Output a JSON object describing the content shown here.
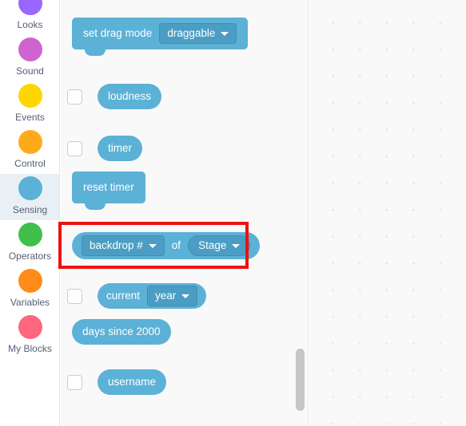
{
  "colors": {
    "sensing_block": "#5cb1d6",
    "sensing_field": "#4b9dc3",
    "highlight": "#ee1111",
    "selected_category_bg": "#e9f0f5",
    "palette_bg": "#f9f9f9",
    "label_text": "#575e75"
  },
  "sidebar": {
    "items": [
      {
        "label": "Looks",
        "color": "#9966ff",
        "selected": false
      },
      {
        "label": "Sound",
        "color": "#cf63cf",
        "selected": false
      },
      {
        "label": "Events",
        "color": "#ffd500",
        "selected": false
      },
      {
        "label": "Control",
        "color": "#ffab19",
        "selected": false
      },
      {
        "label": "Sensing",
        "color": "#5cb1d6",
        "selected": true
      },
      {
        "label": "Operators",
        "color": "#40bf4a",
        "selected": false
      },
      {
        "label": "Variables",
        "color": "#ff8c1a",
        "selected": false
      },
      {
        "label": "My Blocks",
        "color": "#ff6680",
        "selected": false
      }
    ]
  },
  "palette": {
    "blocks": [
      {
        "id": "set-drag-mode",
        "type": "stack",
        "checkbox": false,
        "label": "set drag mode",
        "field": {
          "value": "draggable",
          "shape": "rect",
          "has_arrow": true
        }
      },
      {
        "id": "loudness",
        "type": "reporter",
        "checkbox": true,
        "label": "loudness",
        "field": null
      },
      {
        "id": "timer",
        "type": "reporter",
        "checkbox": true,
        "label": "timer",
        "field": null
      },
      {
        "id": "reset-timer",
        "type": "stack",
        "checkbox": false,
        "label": "reset timer",
        "field": null
      },
      {
        "id": "backdrop-of-stage",
        "type": "reporter",
        "checkbox": false,
        "highlighted": true,
        "label": "",
        "field": {
          "value": "backdrop #",
          "shape": "rect",
          "has_arrow": true
        },
        "mid_text": "of",
        "field2": {
          "value": "Stage",
          "shape": "oval",
          "has_arrow": true
        }
      },
      {
        "id": "current-year",
        "type": "reporter",
        "checkbox": true,
        "label": "current",
        "field": {
          "value": "year",
          "shape": "rect",
          "has_arrow": true
        }
      },
      {
        "id": "days-since-2000",
        "type": "reporter",
        "checkbox": false,
        "label": "days since 2000",
        "field": null
      },
      {
        "id": "username",
        "type": "reporter",
        "checkbox": true,
        "label": "username",
        "field": null
      }
    ]
  },
  "workspace": {
    "grid": "dots"
  }
}
